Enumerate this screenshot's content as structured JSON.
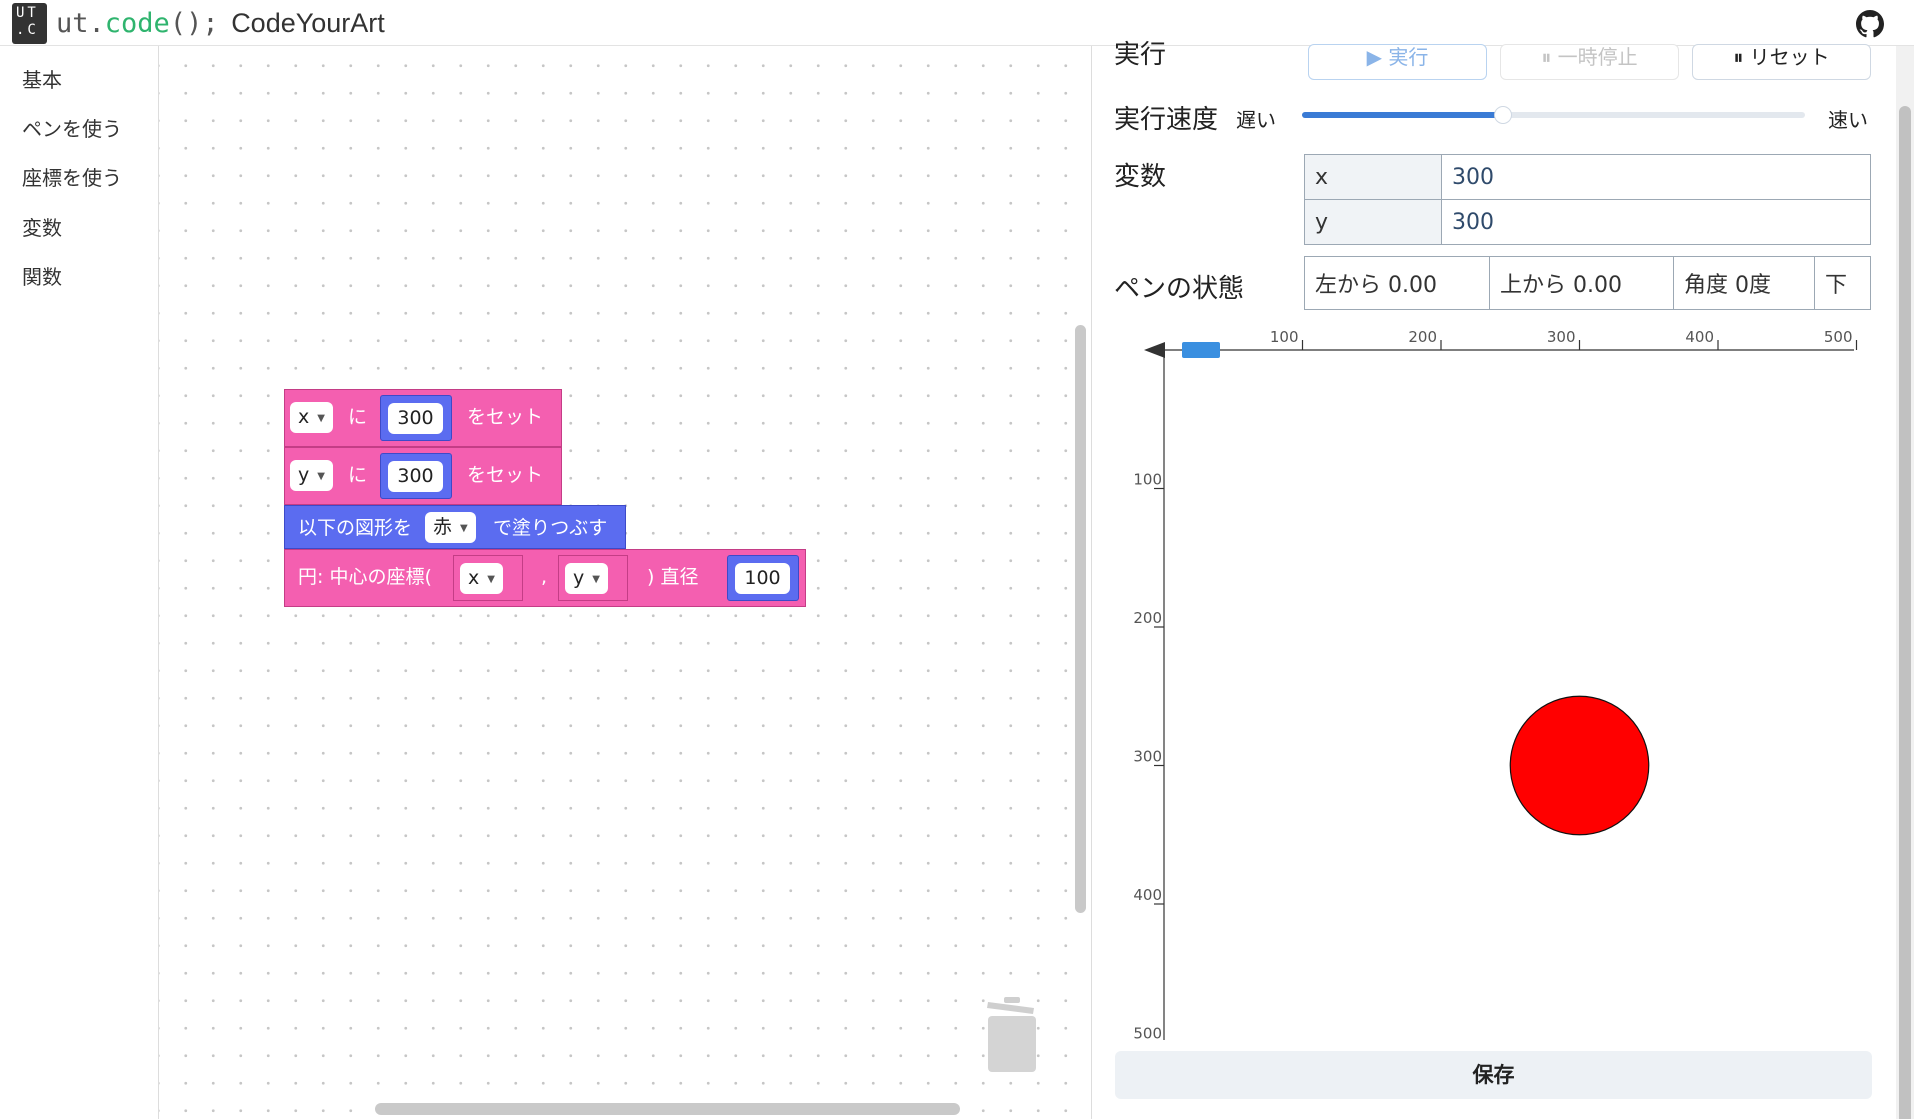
{
  "header": {
    "logo_line1": "UT",
    "logo_line2": ".C",
    "title_prefix": "ut.",
    "title_kw": "code",
    "title_suffix": "();",
    "title_name": "CodeYourArt"
  },
  "toolbox": {
    "categories": [
      "基本",
      "ペンを使う",
      "座標を使う",
      "変数",
      "関数"
    ]
  },
  "blocks": {
    "set_x": {
      "var": "x",
      "ni": "に",
      "value": "300",
      "suffix": "をセット"
    },
    "set_y": {
      "var": "y",
      "ni": "に",
      "value": "300",
      "suffix": "をセット"
    },
    "fill": {
      "prefix": "以下の図形を",
      "color": "赤",
      "suffix": "で塗りつぶす"
    },
    "circle": {
      "prefix": "円: 中心の座標(",
      "x": "x",
      "comma": ",",
      "y": "y",
      "mid": ") 直径",
      "diameter": "100"
    }
  },
  "controls": {
    "run_label": "実行",
    "run_button": "▶ 実行",
    "pause_button": "⏸ 一時停止",
    "reset_button": "⏸ リセット",
    "speed_label": "実行速度",
    "slow": "遅い",
    "fast": "速い",
    "speed_value": 0.4
  },
  "variables": {
    "label": "変数",
    "rows": [
      {
        "name": "x",
        "value": "300"
      },
      {
        "name": "y",
        "value": "300"
      }
    ]
  },
  "pen_state": {
    "label": "ペンの状態",
    "left": "左から 0.00",
    "top": "上から 0.00",
    "angle": "角度 0度",
    "pen": "下"
  },
  "canvas": {
    "x_ticks": [
      "100",
      "200",
      "300",
      "400",
      "500"
    ],
    "y_ticks": [
      "100",
      "200",
      "300",
      "400",
      "500"
    ],
    "circle": {
      "cx": 300,
      "cy": 300,
      "diameter": 100,
      "color": "#ff0000"
    },
    "pen_color": "#3a8fe0"
  },
  "save_button": "保存",
  "icons": {
    "github": "github-icon",
    "trash": "trash-icon"
  }
}
